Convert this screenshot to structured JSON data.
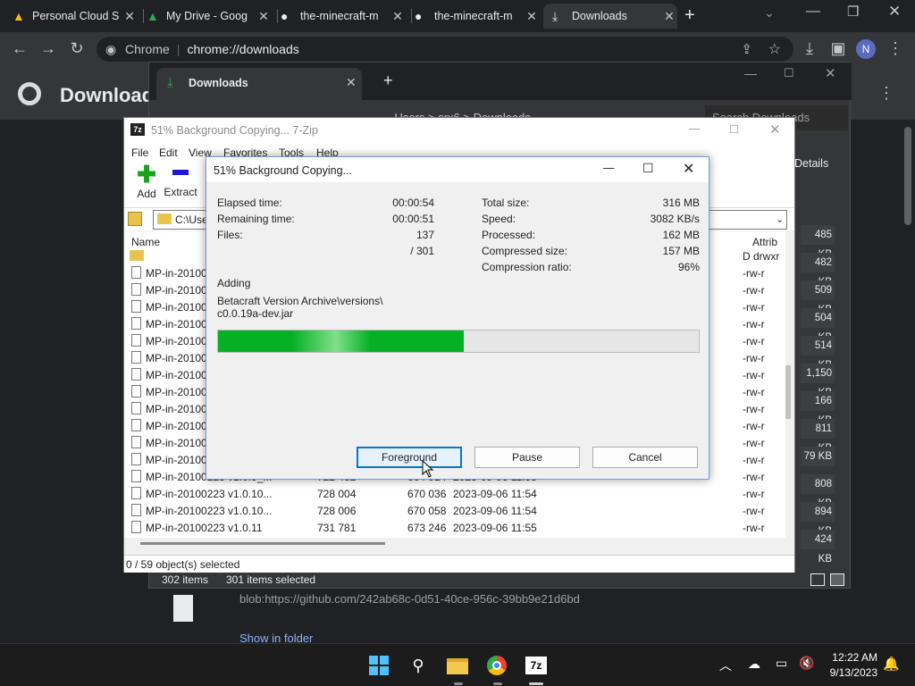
{
  "chrome": {
    "tabs": [
      {
        "title": "Personal Cloud S",
        "icon": "google-drive-icon"
      },
      {
        "title": "My Drive - Goog",
        "icon": "google-drive-icon"
      },
      {
        "title": "the-minecraft-m",
        "icon": "github-icon"
      },
      {
        "title": "the-minecraft-m",
        "icon": "github-icon"
      },
      {
        "title": "Downloads",
        "icon": "download-icon"
      }
    ],
    "new_tab": "+",
    "url_label": "Chrome",
    "url": "chrome://downloads",
    "profile_initial": "N",
    "page_title": "Downloads"
  },
  "second_window": {
    "tab_title": "Downloads",
    "path_crumbs": "... Users > srx6 > Downloads",
    "search_placeholder": "Search Downloads",
    "details": "Details",
    "status_items": "302 items",
    "status_selected": "301 items selected",
    "sizes": [
      "485 KB",
      "482 KB",
      "509 KB",
      "504 KB",
      "514 KB",
      "1,150 KB",
      "166 KB",
      "811 KB",
      "79 KB",
      "808 KB",
      "894 KB",
      "424 KB"
    ]
  },
  "downloads": {
    "blob_url": "blob:https://github.com/242ab68c-0d51-40ce-956c-39bb9e21d6bd",
    "show_in_folder": "Show in folder"
  },
  "zip": {
    "title": "51% Background Copying... 7-Zip",
    "menu": [
      "File",
      "Edit",
      "View",
      "Favorites",
      "Tools",
      "Help"
    ],
    "add": "Add",
    "extract": "Extract",
    "address": "C:\\Use",
    "col_name": "Name",
    "col_attrib": "Attrib",
    "rows": [
      {
        "name": "",
        "size": "",
        "packed": "",
        "date": "",
        "attr": "D drwxr"
      },
      {
        "name": "MP-in-20100",
        "size": "",
        "packed": "",
        "date": "",
        "attr": "-rw-r"
      },
      {
        "name": "MP-in-20100",
        "size": "",
        "packed": "",
        "date": "",
        "attr": "-rw-r"
      },
      {
        "name": "MP-in-20100",
        "size": "",
        "packed": "",
        "date": "",
        "attr": "-rw-r"
      },
      {
        "name": "MP-in-20100",
        "size": "",
        "packed": "",
        "date": "",
        "attr": "-rw-r"
      },
      {
        "name": "MP-in-20100",
        "size": "",
        "packed": "",
        "date": "",
        "attr": "-rw-r"
      },
      {
        "name": "MP-in-20100",
        "size": "",
        "packed": "",
        "date": "",
        "attr": "-rw-r"
      },
      {
        "name": "MP-in-20100",
        "size": "",
        "packed": "",
        "date": "",
        "attr": "-rw-r"
      },
      {
        "name": "MP-in-20100",
        "size": "",
        "packed": "",
        "date": "",
        "attr": "-rw-r"
      },
      {
        "name": "MP-in-20100",
        "size": "",
        "packed": "",
        "date": "",
        "attr": "-rw-r"
      },
      {
        "name": "MP-in-20100",
        "size": "",
        "packed": "",
        "date": "",
        "attr": "-rw-r"
      },
      {
        "name": "MP-in-20100",
        "size": "",
        "packed": "",
        "date": "",
        "attr": "-rw-r"
      },
      {
        "name": "MP-in-20100",
        "size": "",
        "packed": "",
        "date": "",
        "attr": "-rw-r"
      },
      {
        "name": "MP-in-20100223 v1.0.9_...",
        "size": "722 482",
        "packed": "664 914",
        "date": "2023-09-06 11:55",
        "attr": "-rw-r"
      },
      {
        "name": "MP-in-20100223 v1.0.10...",
        "size": "728 004",
        "packed": "670 036",
        "date": "2023-09-06 11:54",
        "attr": "-rw-r"
      },
      {
        "name": "MP-in-20100223 v1.0.10...",
        "size": "728 006",
        "packed": "670 058",
        "date": "2023-09-06 11:54",
        "attr": "-rw-r"
      },
      {
        "name": "MP-in-20100223 v1.0.11",
        "size": "731 781",
        "packed": "673 246",
        "date": "2023-09-06 11:55",
        "attr": "-rw-r"
      }
    ],
    "status": "0 / 59 object(s) selected"
  },
  "dialog": {
    "title": "51% Background Copying...",
    "left": [
      {
        "label": "Elapsed time:",
        "value": "00:00:54"
      },
      {
        "label": "Remaining time:",
        "value": "00:00:51"
      },
      {
        "label": "Files:",
        "value": "137"
      },
      {
        "label": "",
        "value": "/ 301"
      }
    ],
    "right": [
      {
        "label": "Total size:",
        "value": "316 MB"
      },
      {
        "label": "Speed:",
        "value": "3082 KB/s"
      },
      {
        "label": "Processed:",
        "value": "162 MB"
      },
      {
        "label": "Compressed size:",
        "value": "157 MB"
      },
      {
        "label": "Compression ratio:",
        "value": "96%"
      }
    ],
    "action": "Adding",
    "path_line1": "Betacraft Version Archive\\versions\\",
    "path_line2": "c0.0.19a-dev.jar",
    "progress": 0.51,
    "btn_foreground": "Foreground",
    "btn_pause": "Pause",
    "btn_cancel": "Cancel"
  },
  "taskbar": {
    "time": "12:22 AM",
    "date": "9/13/2023",
    "apps": [
      "windows-start-icon",
      "search-icon",
      "file-explorer-icon",
      "chrome-icon",
      "7zip-icon"
    ],
    "zip_label": "7z"
  },
  "colors": {
    "accent": "#0078d7",
    "progress": "#06b025",
    "chrome_bg": "#202124"
  }
}
